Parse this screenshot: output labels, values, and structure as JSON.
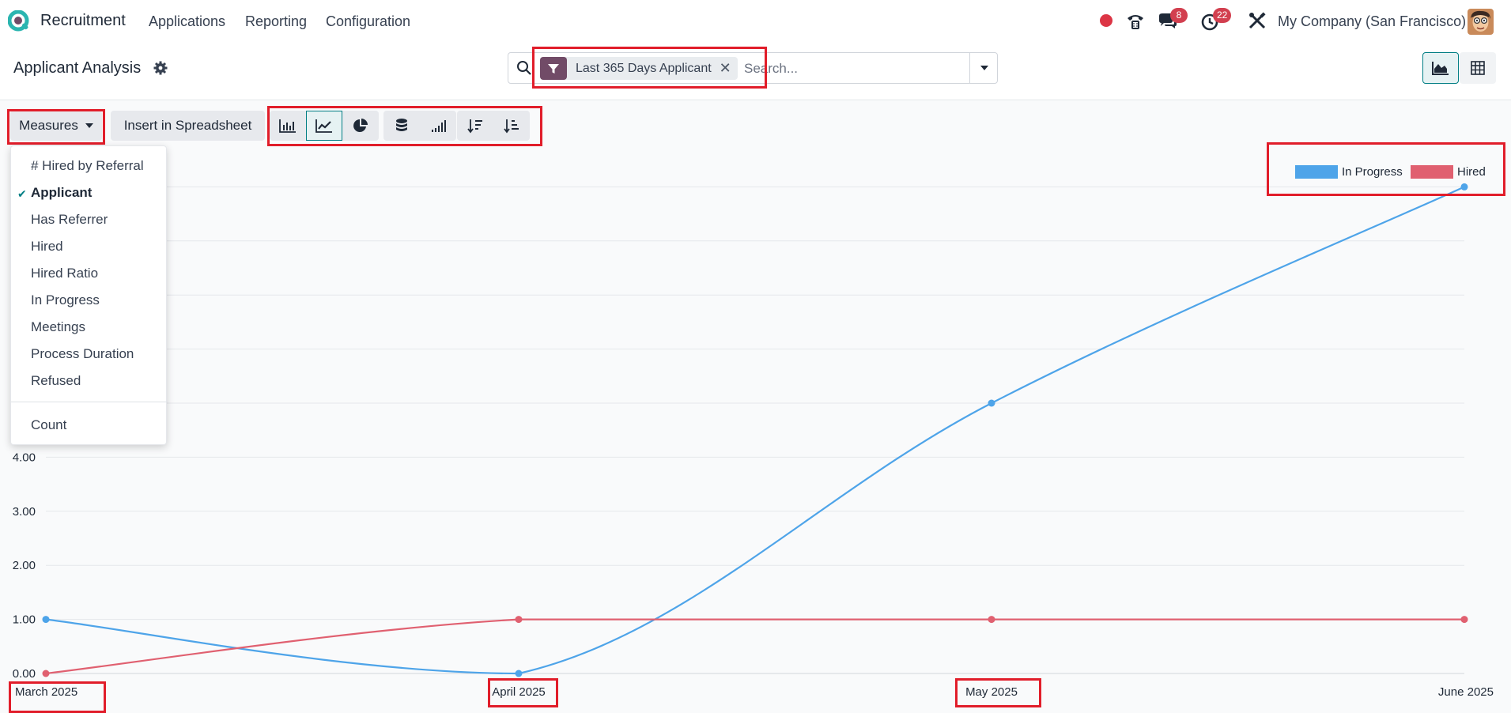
{
  "navbar": {
    "app_name": "Recruitment",
    "menu": [
      "Applications",
      "Reporting",
      "Configuration"
    ],
    "messages_badge": "8",
    "activities_badge": "22",
    "company": "My Company (San Francisco)"
  },
  "control": {
    "title": "Applicant Analysis",
    "facet_label": "Last 365 Days Applicant",
    "search_placeholder": "Search..."
  },
  "toolbar": {
    "measures_label": "Measures",
    "insert_label": "Insert in Spreadsheet"
  },
  "measures_menu": {
    "items": [
      {
        "label": "# Hired by Referral",
        "checked": false
      },
      {
        "label": "Applicant",
        "checked": true
      },
      {
        "label": "Has Referrer",
        "checked": false
      },
      {
        "label": "Hired",
        "checked": false
      },
      {
        "label": "Hired Ratio",
        "checked": false
      },
      {
        "label": "In Progress",
        "checked": false
      },
      {
        "label": "Meetings",
        "checked": false
      },
      {
        "label": "Process Duration",
        "checked": false
      },
      {
        "label": "Refused",
        "checked": false
      }
    ],
    "footer_item": "Count"
  },
  "chart_data": {
    "type": "line",
    "categories": [
      "March 2025",
      "April 2025",
      "May 2025",
      "June 2025"
    ],
    "series": [
      {
        "name": "In Progress",
        "color": "#4ea4e9",
        "values": [
          1,
          0,
          5,
          9
        ]
      },
      {
        "name": "Hired",
        "color": "#e06070",
        "values": [
          0,
          1,
          1,
          1
        ]
      }
    ],
    "y_ticks": [
      "0.00",
      "1.00",
      "2.00",
      "3.00",
      "4.00"
    ],
    "ylim": [
      0,
      9
    ],
    "grid": true,
    "legend_position": "top-right"
  }
}
